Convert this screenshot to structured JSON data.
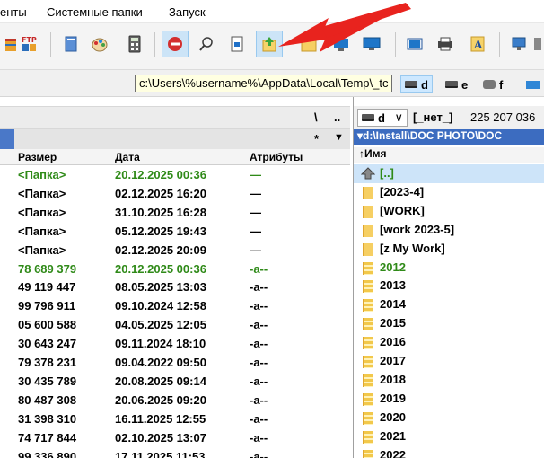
{
  "menu": [
    "енты",
    "Системные папки",
    "Запуск"
  ],
  "toolbar": {
    "icons": [
      "archive-icon",
      "ftp-icon",
      "notebook-icon",
      "paint-icon",
      "calculator-icon",
      "stop-icon",
      "search-icon",
      "copy-names-icon",
      "go-up-icon",
      "folder-icon",
      "display-icon",
      "monitor-icon",
      "image-icon",
      "printer-icon",
      "text-icon",
      "network-icon",
      "pin-icon"
    ],
    "ftp_text": "FTP"
  },
  "pathrow": {
    "tooltip": "c:\\Users\\%username%\\AppData\\Local\\Temp\\_tc",
    "drives": [
      "d",
      "e",
      "f"
    ]
  },
  "left_panel": {
    "nav_up": "\\",
    "nav_dots": "..",
    "star": "*",
    "arrow_down": "▼",
    "columns": [
      "Размер",
      "Дата",
      "Атрибуты"
    ],
    "rows": [
      {
        "size": "<Папка>",
        "date": "20.12.2025 00:36",
        "attr": "—",
        "green": true
      },
      {
        "size": "<Папка>",
        "date": "02.12.2025 16:20",
        "attr": "—",
        "green": false
      },
      {
        "size": "<Папка>",
        "date": "31.10.2025 16:28",
        "attr": "—",
        "green": false
      },
      {
        "size": "<Папка>",
        "date": "05.12.2025 19:43",
        "attr": "—",
        "green": false
      },
      {
        "size": "<Папка>",
        "date": "02.12.2025 20:09",
        "attr": "—",
        "green": false
      },
      {
        "size": "78 689 379",
        "date": "20.12.2025 00:36",
        "attr": "-a--",
        "green": true
      },
      {
        "size": "49 119 447",
        "date": "08.05.2025 13:03",
        "attr": "-a--",
        "green": false
      },
      {
        "size": "99 796 911",
        "date": "09.10.2024 12:58",
        "attr": "-a--",
        "green": false
      },
      {
        "size": "05 600 588",
        "date": "04.05.2025 12:05",
        "attr": "-a--",
        "green": false
      },
      {
        "size": "30 643 247",
        "date": "09.11.2024 18:10",
        "attr": "-a--",
        "green": false
      },
      {
        "size": "79 378 231",
        "date": "09.04.2022 09:50",
        "attr": "-a--",
        "green": false
      },
      {
        "size": "30 435 789",
        "date": "20.08.2025 09:14",
        "attr": "-a--",
        "green": false
      },
      {
        "size": "80 487 308",
        "date": "20.06.2025 09:20",
        "attr": "-a--",
        "green": false
      },
      {
        "size": "31 398 310",
        "date": "16.11.2025 12:55",
        "attr": "-a--",
        "green": false
      },
      {
        "size": "74 717 844",
        "date": "02.10.2025 13:07",
        "attr": "-a--",
        "green": false
      },
      {
        "size": "99 336 890",
        "date": "17.11.2025 11:53",
        "attr": "-a--",
        "green": false
      }
    ]
  },
  "right_panel": {
    "drive": "d",
    "drive_arrow": "∨",
    "label": "[_нет_]",
    "free": "225 207 036",
    "path": "▾d:\\Install\\DOC  PHOTO\\DOC",
    "name_header": "↑Имя",
    "rows": [
      {
        "name": "[..]",
        "type": "up",
        "green": true,
        "selected": true
      },
      {
        "name": "[2023-4]",
        "type": "folder",
        "green": false
      },
      {
        "name": "[WORK]",
        "type": "folder",
        "green": false
      },
      {
        "name": "[work 2023-5]",
        "type": "folder",
        "green": false
      },
      {
        "name": "[z My Work]",
        "type": "folder",
        "green": false
      },
      {
        "name": "2012",
        "type": "archive",
        "green": true
      },
      {
        "name": "2013",
        "type": "archive",
        "green": false
      },
      {
        "name": "2014",
        "type": "archive",
        "green": false
      },
      {
        "name": "2015",
        "type": "archive",
        "green": false
      },
      {
        "name": "2016",
        "type": "archive",
        "green": false
      },
      {
        "name": "2017",
        "type": "archive",
        "green": false
      },
      {
        "name": "2018",
        "type": "archive",
        "green": false
      },
      {
        "name": "2019",
        "type": "archive",
        "green": false
      },
      {
        "name": "2020",
        "type": "archive",
        "green": false
      },
      {
        "name": "2021",
        "type": "archive",
        "green": false
      },
      {
        "name": "2022",
        "type": "archive",
        "green": false
      }
    ]
  },
  "colors": {
    "green": "#2f8a18",
    "path_blue": "#3c6cc0",
    "arrow_red": "#e8231e",
    "tooltip_bg": "#ffffe1"
  }
}
